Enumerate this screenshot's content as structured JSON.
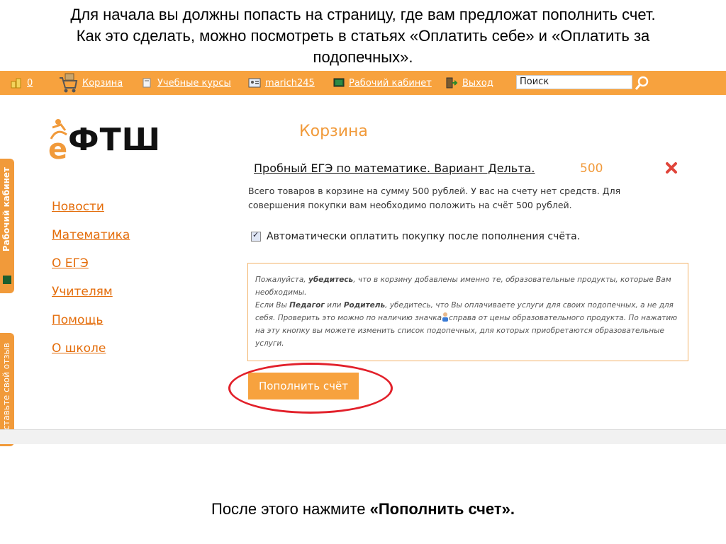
{
  "slide": {
    "top_text_line1": "Для начала вы должны попасть на страницу, где вам предложат пополнить счет.",
    "top_text_line2": "Как это сделать, можно посмотреть в статьях «Оплатить себе» и «Оплатить за",
    "top_text_line3": "подопечных».",
    "bottom_text_prefix": "После этого нажмите ",
    "bottom_text_bold": "«Пополнить счет»."
  },
  "navbar": {
    "items": [
      {
        "label": "0",
        "icon": "coins-icon"
      },
      {
        "label": "Корзина",
        "icon": "cart-icon"
      },
      {
        "label": "Учебные курсы",
        "icon": "book-icon"
      },
      {
        "label": "marich245",
        "icon": "user-card-icon"
      },
      {
        "label": "Рабочий кабинет",
        "icon": "monitor-icon"
      },
      {
        "label": "Выход",
        "icon": "exit-icon"
      }
    ],
    "search_value": "Поиск"
  },
  "logo": {
    "text": "ФТШ",
    "letter": "е"
  },
  "sidebar": {
    "links": [
      "Новости",
      "Математика",
      "О ЕГЭ",
      "Учителям",
      "Помощь",
      "О школе"
    ],
    "tab_cabinet": "Рабочий кабинет",
    "tab_feedback": "Оставьте свой отзыв"
  },
  "cart": {
    "title": "Корзина",
    "item_name": "Пробный ЕГЭ по математике. Вариант Дельта.",
    "item_price": "500",
    "summary": "Всего товаров в корзине на сумму 500 рублей. У вас на счету нет средств. Для совершения покупки вам необходимо положить на счёт 500 рублей.",
    "auto_pay_label": "Автоматически оплатить покупку после пополнения счёта.",
    "auto_pay_checked": true,
    "notice_p1_a": "Пожалуйста, ",
    "notice_p1_b": "убедитесь",
    "notice_p1_c": ", что в корзину добавлены именно те, образовательные продукты, которые Вам необходимы.",
    "notice_p2_a": "Если Вы ",
    "notice_p2_b": "Педагог",
    "notice_p2_c": " или ",
    "notice_p2_d": "Родитель",
    "notice_p2_e": ", убедитесь, что Вы оплачиваете услуги для своих подопечных, а не для себя. Проверить это можно по наличию значка",
    "notice_p2_f": "справа от цены образовательного продукта. По нажатию на эту кнопку вы можете изменить список подопечных, для которых приобретаются образовательные услуги.",
    "topup_button": "Пополнить счёт"
  },
  "colors": {
    "accent": "#f7a23e",
    "link": "#e46d0b",
    "highlight_circle": "#e2202a"
  }
}
